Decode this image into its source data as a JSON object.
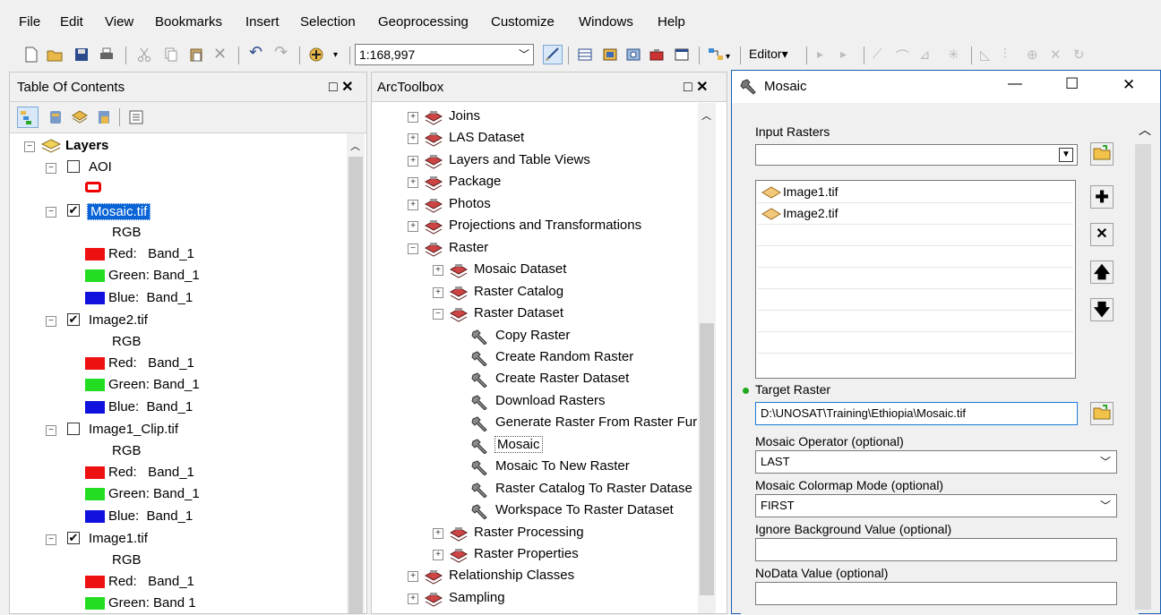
{
  "menu": [
    "File",
    "Edit",
    "View",
    "Bookmarks",
    "Insert",
    "Selection",
    "Geoprocessing",
    "Customize",
    "Windows",
    "Help"
  ],
  "toolbar": {
    "scale": "1:168,997",
    "editor_label": "Editor▾"
  },
  "toc": {
    "title": "Table Of Contents",
    "close": "□ ✕",
    "root": "Layers",
    "aoi": "AOI",
    "layers": [
      {
        "name": "Mosaic.tif",
        "checked": true,
        "rgb": "RGB",
        "red": "Red:   Band_1",
        "green": "Green: Band_1",
        "blue": "Blue:  Band_1"
      },
      {
        "name": "Image2.tif",
        "checked": true,
        "rgb": "RGB",
        "red": "Red:   Band_1",
        "green": "Green: Band_1",
        "blue": "Blue:  Band_1"
      },
      {
        "name": "Image1_Clip.tif",
        "checked": false,
        "rgb": "RGB",
        "red": "Red:   Band_1",
        "green": "Green: Band_1",
        "blue": "Blue:  Band_1"
      },
      {
        "name": "Image1.tif",
        "checked": true,
        "rgb": "RGB",
        "red": "Red:   Band_1",
        "green": "Green: Band 1"
      }
    ]
  },
  "arctoolbox": {
    "title": "ArcToolbox",
    "close": "□ ✕",
    "items": [
      {
        "label": "Joins",
        "level": 0,
        "exp": "+"
      },
      {
        "label": "LAS Dataset",
        "level": 0,
        "exp": "+"
      },
      {
        "label": "Layers and Table Views",
        "level": 0,
        "exp": "+"
      },
      {
        "label": "Package",
        "level": 0,
        "exp": "+"
      },
      {
        "label": "Photos",
        "level": 0,
        "exp": "+"
      },
      {
        "label": "Projections and Transformations",
        "level": 0,
        "exp": "+"
      },
      {
        "label": "Raster",
        "level": 0,
        "exp": "−"
      },
      {
        "label": "Mosaic Dataset",
        "level": 1,
        "exp": "+"
      },
      {
        "label": "Raster Catalog",
        "level": 1,
        "exp": "+"
      },
      {
        "label": "Raster Dataset",
        "level": 1,
        "exp": "−"
      },
      {
        "label": "Copy Raster",
        "level": 2,
        "exp": ""
      },
      {
        "label": "Create Random Raster",
        "level": 2,
        "exp": ""
      },
      {
        "label": "Create Raster Dataset",
        "level": 2,
        "exp": ""
      },
      {
        "label": "Download Rasters",
        "level": 2,
        "exp": ""
      },
      {
        "label": "Generate Raster From Raster Fur",
        "level": 2,
        "exp": ""
      },
      {
        "label": "Mosaic",
        "level": 2,
        "exp": ""
      },
      {
        "label": "Mosaic To New Raster",
        "level": 2,
        "exp": ""
      },
      {
        "label": "Raster Catalog To Raster Datase",
        "level": 2,
        "exp": ""
      },
      {
        "label": "Workspace To Raster Dataset",
        "level": 2,
        "exp": ""
      },
      {
        "label": "Raster Processing",
        "level": 1,
        "exp": "+"
      },
      {
        "label": "Raster Properties",
        "level": 1,
        "exp": "+"
      },
      {
        "label": "Relationship Classes",
        "level": 0,
        "exp": "+"
      },
      {
        "label": "Sampling",
        "level": 0,
        "exp": "+"
      }
    ]
  },
  "dialog": {
    "title": "Mosaic",
    "window_controls": [
      "—",
      "☐",
      "✕"
    ],
    "input_rasters_label": "Input Rasters",
    "rasters": [
      "Image1.tif",
      "Image2.tif"
    ],
    "target_raster_label": "Target Raster",
    "target_raster_value": "D:\\UNOSAT\\Training\\Ethiopia\\Mosaic.tif",
    "mosaic_operator_label": "Mosaic Operator (optional)",
    "mosaic_operator_value": "LAST",
    "colormap_label": "Mosaic Colormap Mode (optional)",
    "colormap_value": "FIRST",
    "ignore_bg_label": "Ignore Background Value (optional)",
    "nodata_label": "NoData Value (optional)"
  },
  "colors": {
    "red": "#ee1111",
    "green": "#22dd22",
    "blue": "#1111dd",
    "selection": "#0a64d6",
    "required_dot": "#1fa81f"
  }
}
